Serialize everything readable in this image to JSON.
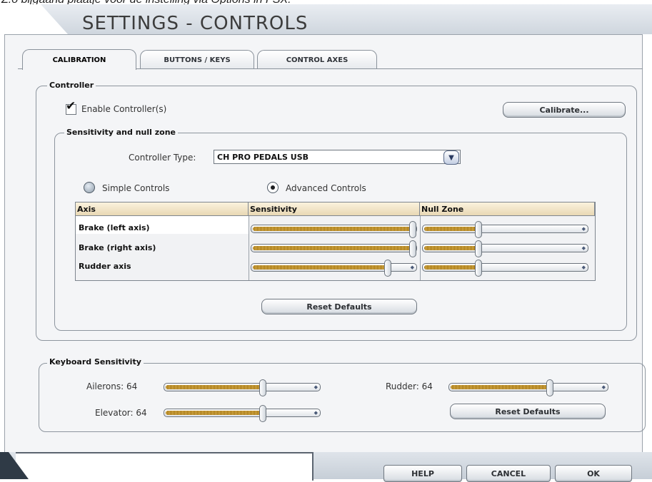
{
  "caption": "Z.o bijgaand plaatje voor de instelling via Options in FSX.",
  "window_title": "SETTINGS - CONTROLS",
  "tabs": [
    {
      "label": "CALIBRATION",
      "active": true
    },
    {
      "label": "BUTTONS / KEYS",
      "active": false
    },
    {
      "label": "CONTROL AXES",
      "active": false
    }
  ],
  "controller": {
    "group_title": "Controller",
    "enable_label": "Enable Controller(s)",
    "enable_checked": true,
    "calibrate_label": "Calibrate..."
  },
  "sensitivity": {
    "group_title": "Sensitivity and null zone",
    "controller_type_label": "Controller Type:",
    "controller_type_value": "CH PRO PEDALS USB",
    "simple_label": "Simple Controls",
    "advanced_label": "Advanced Controls",
    "selected_mode": "advanced",
    "columns": [
      "Axis",
      "Sensitivity",
      "Null Zone"
    ],
    "rows": [
      {
        "axis": "Brake (left axis)",
        "sensitivity": 1.0,
        "null_zone": 0.33
      },
      {
        "axis": "Brake (right axis)",
        "sensitivity": 1.0,
        "null_zone": 0.33
      },
      {
        "axis": "Rudder axis",
        "sensitivity": 0.84,
        "null_zone": 0.33
      }
    ],
    "reset_label": "Reset Defaults"
  },
  "keyboard": {
    "group_title": "Keyboard Sensitivity",
    "ailerons_label": "Ailerons: 64",
    "elevator_label": "Elevator: 64",
    "rudder_label": "Rudder: 64",
    "ailerons_value": 64,
    "elevator_value": 64,
    "rudder_value": 64,
    "reset_label": "Reset Defaults"
  },
  "footer": {
    "help_label": "HELP",
    "cancel_label": "CANCEL",
    "ok_label": "OK"
  },
  "colors": {
    "panel_bg": "#f4f5f7",
    "slider_fill": "#e0b84e",
    "header_bg": "#e9d8b4"
  }
}
